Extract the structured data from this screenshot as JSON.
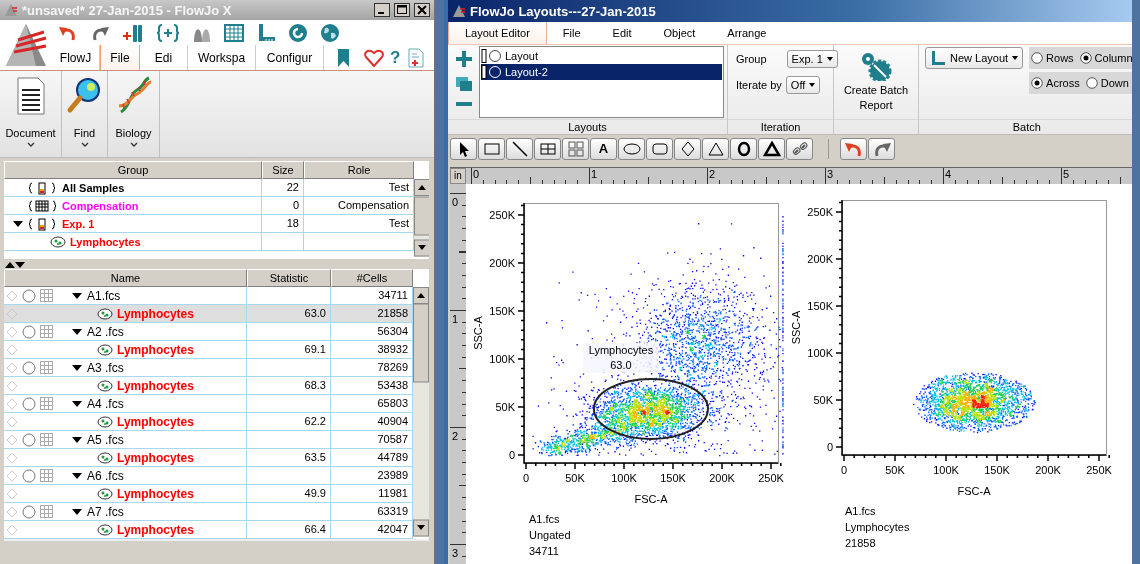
{
  "main_window": {
    "title": "*unsaved* 27-Jan-2015 - FlowJo X",
    "ribbon_tabs": [
      {
        "label": "FlowJ",
        "selected": false
      },
      {
        "label": "File",
        "selected": true
      },
      {
        "label": "Edi",
        "selected": false
      },
      {
        "label": "Workspa",
        "selected": false
      },
      {
        "label": "Configur",
        "selected": false
      }
    ],
    "help_button": "?",
    "ribbon_buttons": [
      {
        "label": "Document",
        "kind": "document"
      },
      {
        "label": "Find",
        "kind": "find"
      },
      {
        "label": "Biology",
        "kind": "biology"
      }
    ],
    "group_table": {
      "columns": [
        "Group",
        "Size",
        "Role"
      ],
      "rows": [
        {
          "name": "All Samples",
          "size": "22",
          "role": "Test",
          "kind": "tube",
          "color": "#000000"
        },
        {
          "name": "Compensation",
          "size": "0",
          "role": "Compensation",
          "kind": "matrix",
          "color": "#ff00ff"
        },
        {
          "name": "Exp. 1",
          "size": "18",
          "role": "Test",
          "kind": "tube",
          "color": "#ff0000",
          "expanded": true,
          "children": [
            {
              "name": "Lymphocytes",
              "kind": "gate",
              "color": "#ff0000"
            }
          ]
        }
      ]
    },
    "sample_table": {
      "columns": [
        "Name",
        "Statistic",
        "#Cells"
      ],
      "rows": [
        {
          "name": "A1.fcs",
          "cells": "34711",
          "selected": false,
          "expanded": true,
          "children": [
            {
              "name": "Lymphocytes",
              "statistic": "63.0",
              "cells": "21858",
              "selected": true
            }
          ]
        },
        {
          "name": "A2 .fcs",
          "cells": "56304",
          "selected": false,
          "expanded": true,
          "children": [
            {
              "name": "Lymphocytes",
              "statistic": "69.1",
              "cells": "38932",
              "selected": false
            }
          ]
        },
        {
          "name": "A3 .fcs",
          "cells": "78269",
          "selected": false,
          "expanded": true,
          "children": [
            {
              "name": "Lymphocytes",
              "statistic": "68.3",
              "cells": "53438",
              "selected": false
            }
          ]
        },
        {
          "name": "A4 .fcs",
          "cells": "65803",
          "selected": false,
          "expanded": true,
          "children": [
            {
              "name": "Lymphocytes",
              "statistic": "62.2",
              "cells": "40904",
              "selected": false
            }
          ]
        },
        {
          "name": "A5 .fcs",
          "cells": "70587",
          "selected": false,
          "expanded": true,
          "children": [
            {
              "name": "Lymphocytes",
              "statistic": "63.5",
              "cells": "44789",
              "selected": false
            }
          ]
        },
        {
          "name": "A6 .fcs",
          "cells": "23989",
          "selected": false,
          "expanded": true,
          "children": [
            {
              "name": "Lymphocytes",
              "statistic": "49.9",
              "cells": "11981",
              "selected": false
            }
          ]
        },
        {
          "name": "A7 .fcs",
          "cells": "63319",
          "selected": false,
          "expanded": true,
          "children": [
            {
              "name": "Lymphocytes",
              "statistic": "66.4",
              "cells": "42047",
              "selected": false
            }
          ]
        }
      ]
    }
  },
  "layout_window": {
    "title": "FlowJo Layouts---27-Jan-2015",
    "tabs": [
      {
        "label": "Layout Editor",
        "selected": true
      },
      {
        "label": "File",
        "selected": false
      },
      {
        "label": "Edit",
        "selected": false
      },
      {
        "label": "Object",
        "selected": false
      },
      {
        "label": "Arrange",
        "selected": false
      }
    ],
    "layouts": [
      {
        "name": "Layout",
        "selected": false
      },
      {
        "name": "Layout-2",
        "selected": true
      }
    ],
    "layouts_label": "Layouts",
    "group_label": "Group",
    "group_value": "Exp. 1",
    "iterate_label": "Iterate by",
    "iterate_value": "Off",
    "iteration_label": "Iteration",
    "batch_report_button": "Create Batch Report",
    "new_layout_button": "New Layout",
    "order_options": [
      {
        "label": "Rows",
        "checked": false
      },
      {
        "label": "Column",
        "checked": true
      }
    ],
    "direction_options": [
      {
        "label": "Across",
        "checked": true
      },
      {
        "label": "Down",
        "checked": false
      }
    ],
    "batch_label": "Batch",
    "text_tool": "A",
    "ruler": {
      "unit": "in",
      "top_marks": [
        "0",
        "1",
        "2",
        "3",
        "4",
        "5"
      ],
      "left_marks": [
        "0",
        "1",
        "2",
        "3"
      ]
    },
    "plots": [
      {
        "kind": "ungated",
        "xlabel": "FSC-A",
        "ylabel": "SSC-A",
        "x_ticks": [
          "0",
          "50K",
          "100K",
          "150K",
          "200K",
          "250K"
        ],
        "y_ticks": [
          "250K",
          "200K",
          "150K",
          "100K",
          "50K",
          "0"
        ],
        "gate": {
          "name": "Lymphocytes",
          "statistic": "63.0"
        },
        "caption": [
          "A1.fcs",
          "Ungated",
          "34711"
        ]
      },
      {
        "kind": "gated",
        "xlabel": "FSC-A",
        "ylabel": "SSC-A",
        "x_ticks": [
          "0",
          "50K",
          "100K",
          "150K",
          "200K",
          "250K"
        ],
        "y_ticks": [
          "250K",
          "200K",
          "150K",
          "100K",
          "50K",
          "0"
        ],
        "caption": [
          "A1.fcs",
          "Lymphocytes",
          "21858"
        ]
      }
    ]
  }
}
